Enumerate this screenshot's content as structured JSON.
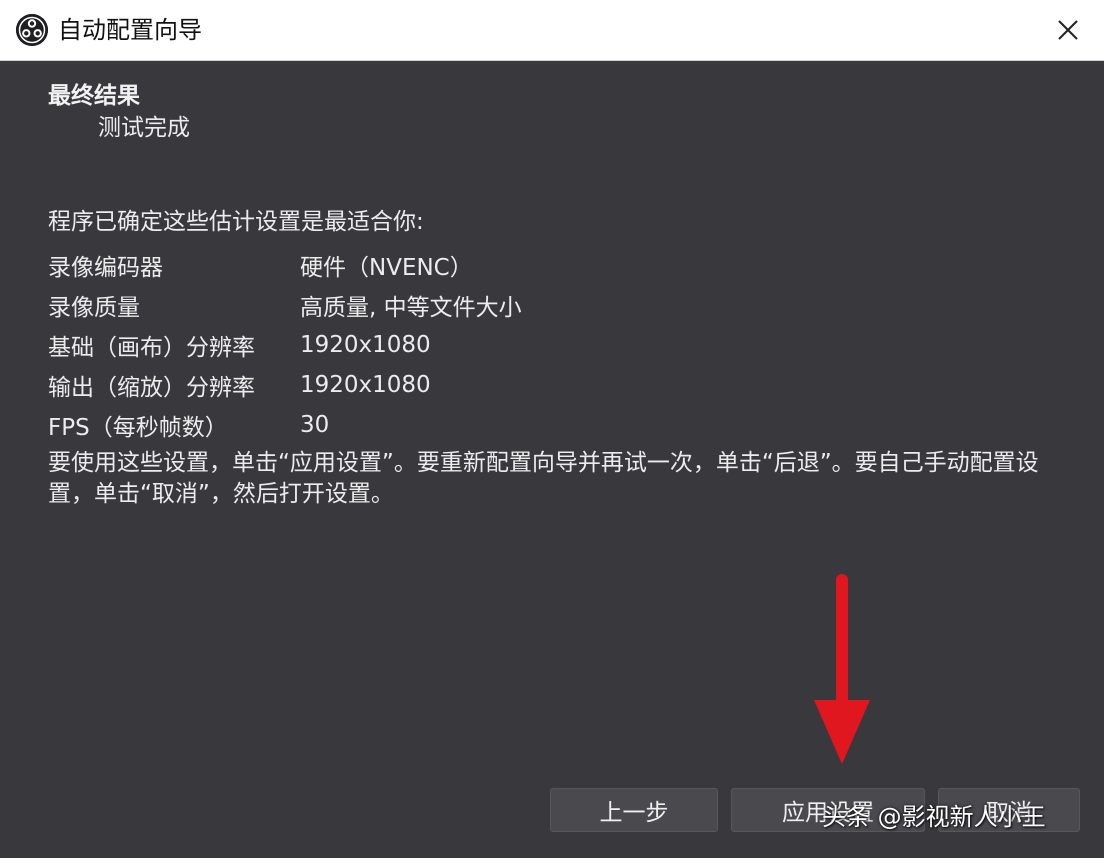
{
  "window": {
    "title": "自动配置向导",
    "app_icon": "obs-logo-icon",
    "close_icon": "close-icon"
  },
  "results": {
    "heading": "最终结果",
    "subheading": "测试完成",
    "intro": "程序已确定这些估计设置是最适合你:",
    "rows": [
      {
        "label": "录像编码器",
        "value": "硬件（NVENC）"
      },
      {
        "label": "录像质量",
        "value": "高质量, 中等文件大小"
      },
      {
        "label": "基础（画布）分辨率",
        "value": "1920x1080"
      },
      {
        "label": "输出（缩放）分辨率",
        "value": "1920x1080"
      },
      {
        "label": "FPS（每秒帧数）",
        "value": "30"
      }
    ],
    "note": "要使用这些设置，单击“应用设置”。要重新配置向导并再试一次，单击“后退”。要自己手动配置设置，单击“取消”，然后打开设置。"
  },
  "buttons": {
    "back": "上一步",
    "apply": "应用设置",
    "cancel": "取消"
  },
  "annotation": {
    "arrow_icon": "red-arrow-down-icon",
    "arrow_color": "#e0171f"
  },
  "watermark": "头条 @影视新人小王",
  "colors": {
    "background": "#39383c",
    "titlebar": "#ffffff",
    "button": "#4a494e"
  }
}
